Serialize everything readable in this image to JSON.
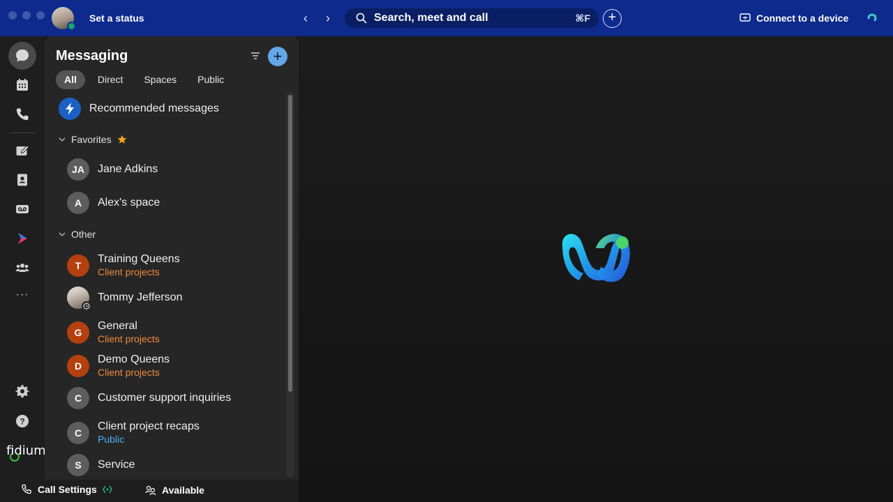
{
  "titlebar": {
    "status_label": "Set a status",
    "search_placeholder": "Search, meet and call",
    "search_shortcut": "⌘F",
    "connect_label": "Connect to a device"
  },
  "rail": {
    "items": [
      "chat-icon",
      "calendar-icon",
      "phone-icon",
      "whiteboard-icon",
      "contacts-icon",
      "voicemail-icon",
      "vidcast-icon",
      "teams-icon",
      "more-icon",
      "settings-icon",
      "help-icon"
    ],
    "more_label": "···",
    "brand": "fidium"
  },
  "messaging": {
    "title": "Messaging",
    "tabs": [
      "All",
      "Direct",
      "Spaces",
      "Public"
    ],
    "recommended": "Recommended messages",
    "favorites_label": "Favorites",
    "other_label": "Other",
    "favorites": [
      {
        "initials": "JA",
        "name": "Jane Adkins"
      },
      {
        "initials": "A",
        "name": "Alex's space"
      }
    ],
    "others": [
      {
        "initials": "T",
        "name": "Training Queens",
        "sub": "Client projects",
        "color": "#b5400f"
      },
      {
        "initials": "",
        "name": "Tommy Jefferson",
        "sub": "",
        "color": "photo"
      },
      {
        "initials": "G",
        "name": "General",
        "sub": "Client projects",
        "color": "#b5400f"
      },
      {
        "initials": "D",
        "name": "Demo Queens",
        "sub": "Client projects",
        "color": "#b5400f"
      },
      {
        "initials": "C",
        "name": "Customer support inquiries",
        "sub": "",
        "color": "#5d5d5d"
      },
      {
        "initials": "C",
        "name": "Client project recaps",
        "sub": "Public",
        "color": "#5d5d5d"
      },
      {
        "initials": "S",
        "name": "Service",
        "sub": "",
        "color": "#5d5d5d"
      }
    ]
  },
  "bottombar": {
    "call_settings": "Call Settings",
    "availability": "Available"
  },
  "colors": {
    "titlebar": "#0d2a8c",
    "accent_orange": "#f08a3c",
    "accent_blue": "#4fb0f2",
    "avatar_orange": "#b5400f"
  }
}
